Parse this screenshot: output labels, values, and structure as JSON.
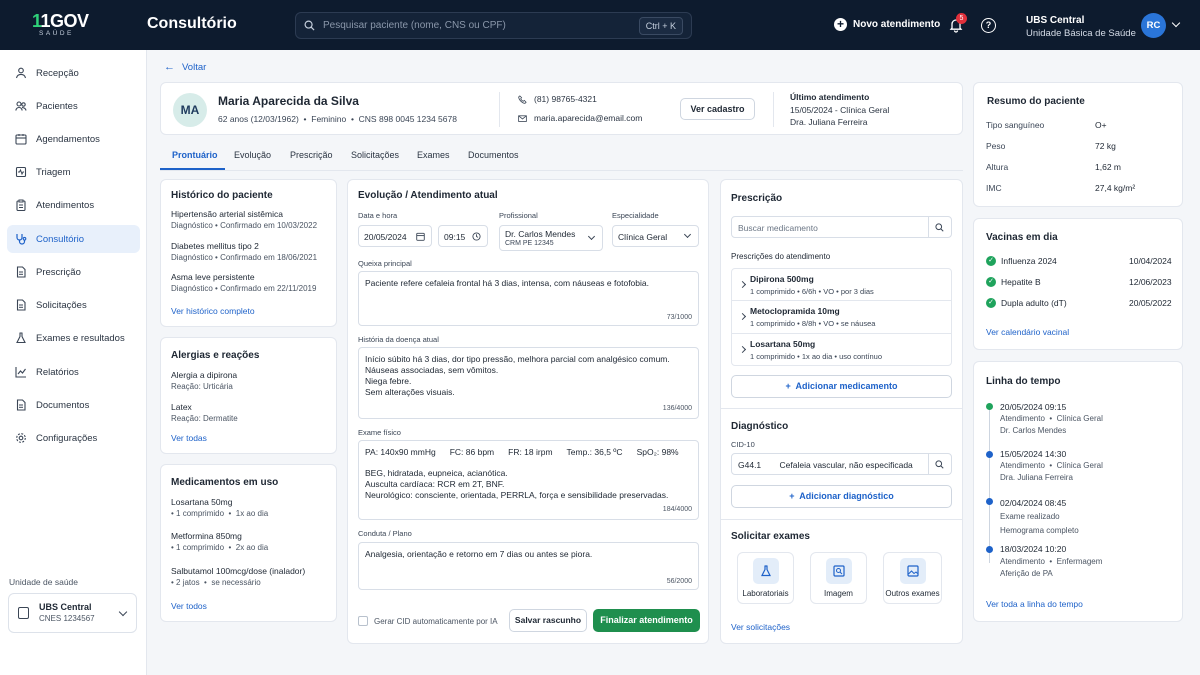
{
  "header": {
    "logo_main": "1GOV",
    "logo_sub": "SAÚDE",
    "app_title": "Consultório",
    "search_placeholder": "Pesquisar paciente (nome, CNS ou CPF)",
    "search_shortcut": "Ctrl + K",
    "new_attendance": "Novo atendimento",
    "notifications_count": "5",
    "unit_name": "UBS Central",
    "unit_type": "Unidade Básica de Saúde",
    "user_initials": "RC"
  },
  "sidebar": {
    "items": [
      {
        "label": "Recepção",
        "icon": "users-icon"
      },
      {
        "label": "Pacientes",
        "icon": "patients-icon"
      },
      {
        "label": "Agendamentos",
        "icon": "calendar-icon"
      },
      {
        "label": "Triagem",
        "icon": "triage-icon"
      },
      {
        "label": "Atendimentos",
        "icon": "clipboard-icon"
      },
      {
        "label": "Consultório",
        "icon": "stethoscope-icon"
      },
      {
        "label": "Prescrição",
        "icon": "document-icon"
      },
      {
        "label": "Solicitações",
        "icon": "document-icon"
      },
      {
        "label": "Exames e resultados",
        "icon": "flask-icon"
      },
      {
        "label": "Relatórios",
        "icon": "chart-icon"
      },
      {
        "label": "Documentos",
        "icon": "document-icon"
      },
      {
        "label": "Configurações",
        "icon": "gear-icon"
      }
    ],
    "unit_label": "Unidade de saúde",
    "unit_name": "UBS Central",
    "unit_cnes": "CNES 1234567"
  },
  "back_label": "Voltar",
  "patient": {
    "initials": "MA",
    "name": "Maria Aparecida da Silva",
    "age": "62 anos (12/03/1962)",
    "sex": "Feminino",
    "cns": "CNS 898 0045 1234 5678",
    "phone": "(81) 98765-4321",
    "email": "maria.aparecida@email.com",
    "view_button": "Ver cadastro",
    "last_title": "Último atendimento",
    "last_line1": "15/05/2024 - Clínica Geral",
    "last_line2": "Dra. Juliana Ferreira"
  },
  "tabs": [
    "Prontuário",
    "Evolução",
    "Prescrição",
    "Solicitações",
    "Exames",
    "Documentos"
  ],
  "history": {
    "title": "Histórico do paciente",
    "items": [
      {
        "name": "Hipertensão arterial sistêmica",
        "type": "Diagnóstico",
        "status": "Confirmado em 10/03/2022"
      },
      {
        "name": "Diabetes mellitus tipo 2",
        "type": "Diagnóstico",
        "status": "Confirmado em 18/06/2021"
      },
      {
        "name": "Asma leve persistente",
        "type": "Diagnóstico",
        "status": "Confirmado em 22/11/2019"
      }
    ],
    "link": "Ver histórico completo"
  },
  "allergies": {
    "title": "Alergias e reações",
    "items": [
      {
        "name": "Alergia a dipirona",
        "reaction": "Reação: Urticária"
      },
      {
        "name": "Latex",
        "reaction": "Reação: Dermatite"
      }
    ],
    "link": "Ver todas"
  },
  "meds": {
    "title": "Medicamentos em uso",
    "items": [
      {
        "name": "Losartana 50mg",
        "dose": "1 comprimido",
        "freq": "1x ao dia"
      },
      {
        "name": "Metformina 850mg",
        "dose": "1 comprimido",
        "freq": "2x ao dia"
      },
      {
        "name": "Salbutamol 100mcg/dose (inalador)",
        "dose": "2 jatos",
        "freq": "se necessário"
      }
    ],
    "link": "Ver todos"
  },
  "evolution": {
    "title": "Evolução / Atendimento atual",
    "date_label": "Data e hora",
    "date": "20/05/2024",
    "time": "09:15",
    "prof_label": "Profissional",
    "prof_name": "Dr. Carlos Mendes",
    "prof_crm": "CRM PE 12345",
    "spec_label": "Especialidade",
    "spec": "Clínica Geral",
    "complaint_label": "Queixa principal",
    "complaint": "Paciente refere cefaleia frontal há 3 dias, intensa, com náuseas e fotofobia.",
    "complaint_count": "73/1000",
    "hda_label": "História da doença atual",
    "hda_lines": [
      "Início súbito há 3 dias, dor tipo pressão, melhora parcial com analgésico comum.",
      "Náuseas associadas, sem vômitos.",
      "Niega febre.",
      "Sem alterações visuais."
    ],
    "hda_count": "136/4000",
    "exam_label": "Exame físico",
    "exam_vitals": [
      "PA: 140x90 mmHg",
      "FC: 86 bpm",
      "FR: 18 irpm",
      "Temp.: 36,5 ºC",
      "SpO₂: 98%"
    ],
    "exam_lines": [
      "BEG, hidratada, eupneica, acianótica.",
      "Ausculta cardíaca: RCR em 2T, BNF.",
      "Neurológico: consciente, orientada, PERRLA, força e sensibilidade preservadas."
    ],
    "exam_count": "184/4000",
    "plan_label": "Conduta / Plano",
    "plan": "Analgesia, orientação e retorno em 7 dias ou antes se piora.",
    "plan_count": "56/2000",
    "ai_checkbox": "Gerar CID automaticamente por IA",
    "save_draft": "Salvar rascunho",
    "finish": "Finalizar atendimento"
  },
  "prescription": {
    "title": "Prescrição",
    "search_placeholder": "Buscar medicamento",
    "list_title": "Prescrições do atendimento",
    "items": [
      {
        "name": "Dipirona 500mg",
        "d1": "1 comprimido",
        "d2": "6/6h",
        "d3": "VO",
        "d4": "por 3 dias"
      },
      {
        "name": "Metoclopramida 10mg",
        "d1": "1 comprimido",
        "d2": "8/8h",
        "d3": "VO",
        "d4": "se náusea"
      },
      {
        "name": "Losartana 50mg",
        "d1": "1 comprimido",
        "d2": "1x ao dia",
        "d3": "uso contínuo",
        "d4": ""
      }
    ],
    "add": "Adicionar medicamento"
  },
  "diagnosis": {
    "title": "Diagnóstico",
    "cid_label": "CID-10",
    "cid_code": "G44.1",
    "cid_desc": "Cefaleia vascular, não especificada",
    "add": "Adicionar diagnóstico"
  },
  "exams": {
    "title": "Solicitar exames",
    "items": [
      "Laboratoriais",
      "Imagem",
      "Outros exames"
    ],
    "link": "Ver solicitações"
  },
  "summary": {
    "title": "Resumo do paciente",
    "rows": [
      {
        "k": "Tipo sanguíneo",
        "v": "O+"
      },
      {
        "k": "Peso",
        "v": "72 kg"
      },
      {
        "k": "Altura",
        "v": "1,62 m"
      },
      {
        "k": "IMC",
        "v": "27,4 kg/m²"
      }
    ]
  },
  "vaccines": {
    "title": "Vacinas em dia",
    "items": [
      {
        "name": "Influenza 2024",
        "date": "10/04/2024"
      },
      {
        "name": "Hepatite B",
        "date": "12/06/2023"
      },
      {
        "name": "Dupla adulto (dT)",
        "date": "20/05/2022"
      }
    ],
    "link": "Ver calendário vacinal"
  },
  "timeline": {
    "title": "Linha do tempo",
    "items": [
      {
        "when": "20/05/2024  09:15",
        "l1": "Atendimento",
        "l2": "Clínica Geral",
        "l3": "Dr. Carlos Mendes",
        "color": "#1fa35c"
      },
      {
        "when": "15/05/2024  14:30",
        "l1": "Atendimento",
        "l2": "Clínica Geral",
        "l3": "Dra. Juliana Ferreira",
        "color": "#1e62c9"
      },
      {
        "when": "02/04/2024  08:45",
        "l1": "Exame realizado",
        "l2": "",
        "l3": "Hemograma completo",
        "color": "#1e62c9"
      },
      {
        "when": "18/03/2024  10:20",
        "l1": "Atendimento",
        "l2": "Enfermagem",
        "l3": "Aferição de PA",
        "color": "#1e62c9"
      }
    ],
    "link": "Ver toda a linha do tempo"
  },
  "colors": {
    "primary": "#1e62c9",
    "success": "#1f8f4e",
    "topbar": "#0d1b2e"
  }
}
